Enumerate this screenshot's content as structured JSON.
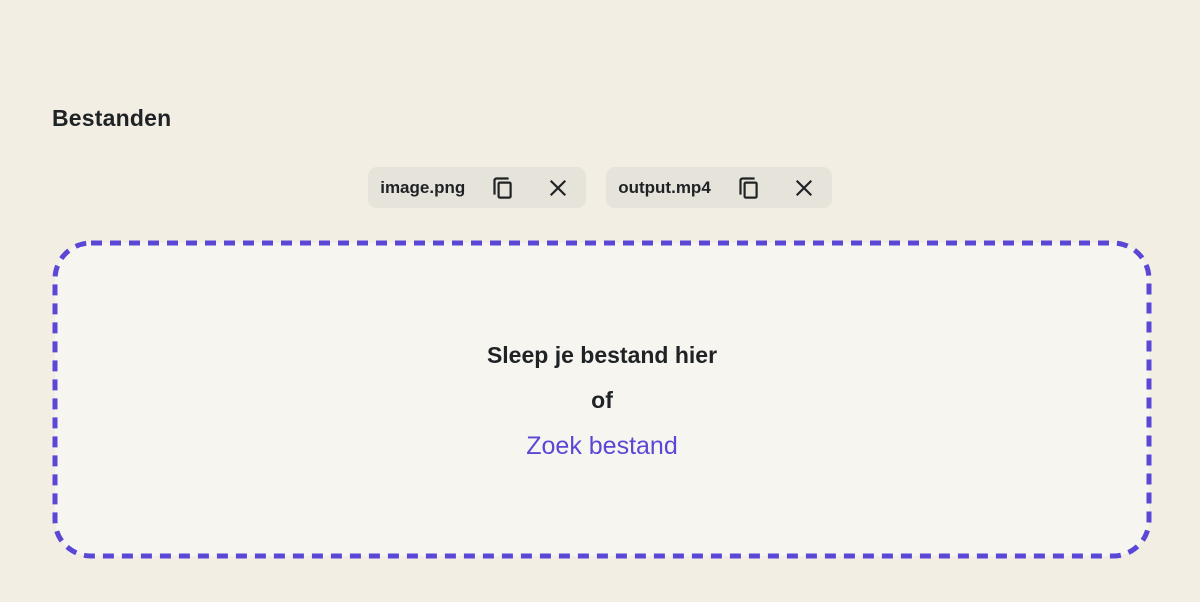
{
  "section": {
    "title": "Bestanden"
  },
  "files": [
    {
      "name": "image.png",
      "copy_icon": "copy-icon",
      "remove_icon": "close-icon"
    },
    {
      "name": "output.mp4",
      "copy_icon": "copy-icon",
      "remove_icon": "close-icon"
    }
  ],
  "dropzone": {
    "drag_text": "Sleep je bestand hier",
    "or_text": "of",
    "browse_link": "Zoek bestand"
  },
  "colors": {
    "page_background": "#f3eee4",
    "dropzone_background": "#f7f5f0",
    "dropzone_border": "#5b47d6",
    "chip_background": "#e6e3da",
    "text": "#202326",
    "link": "#5b47d6"
  }
}
